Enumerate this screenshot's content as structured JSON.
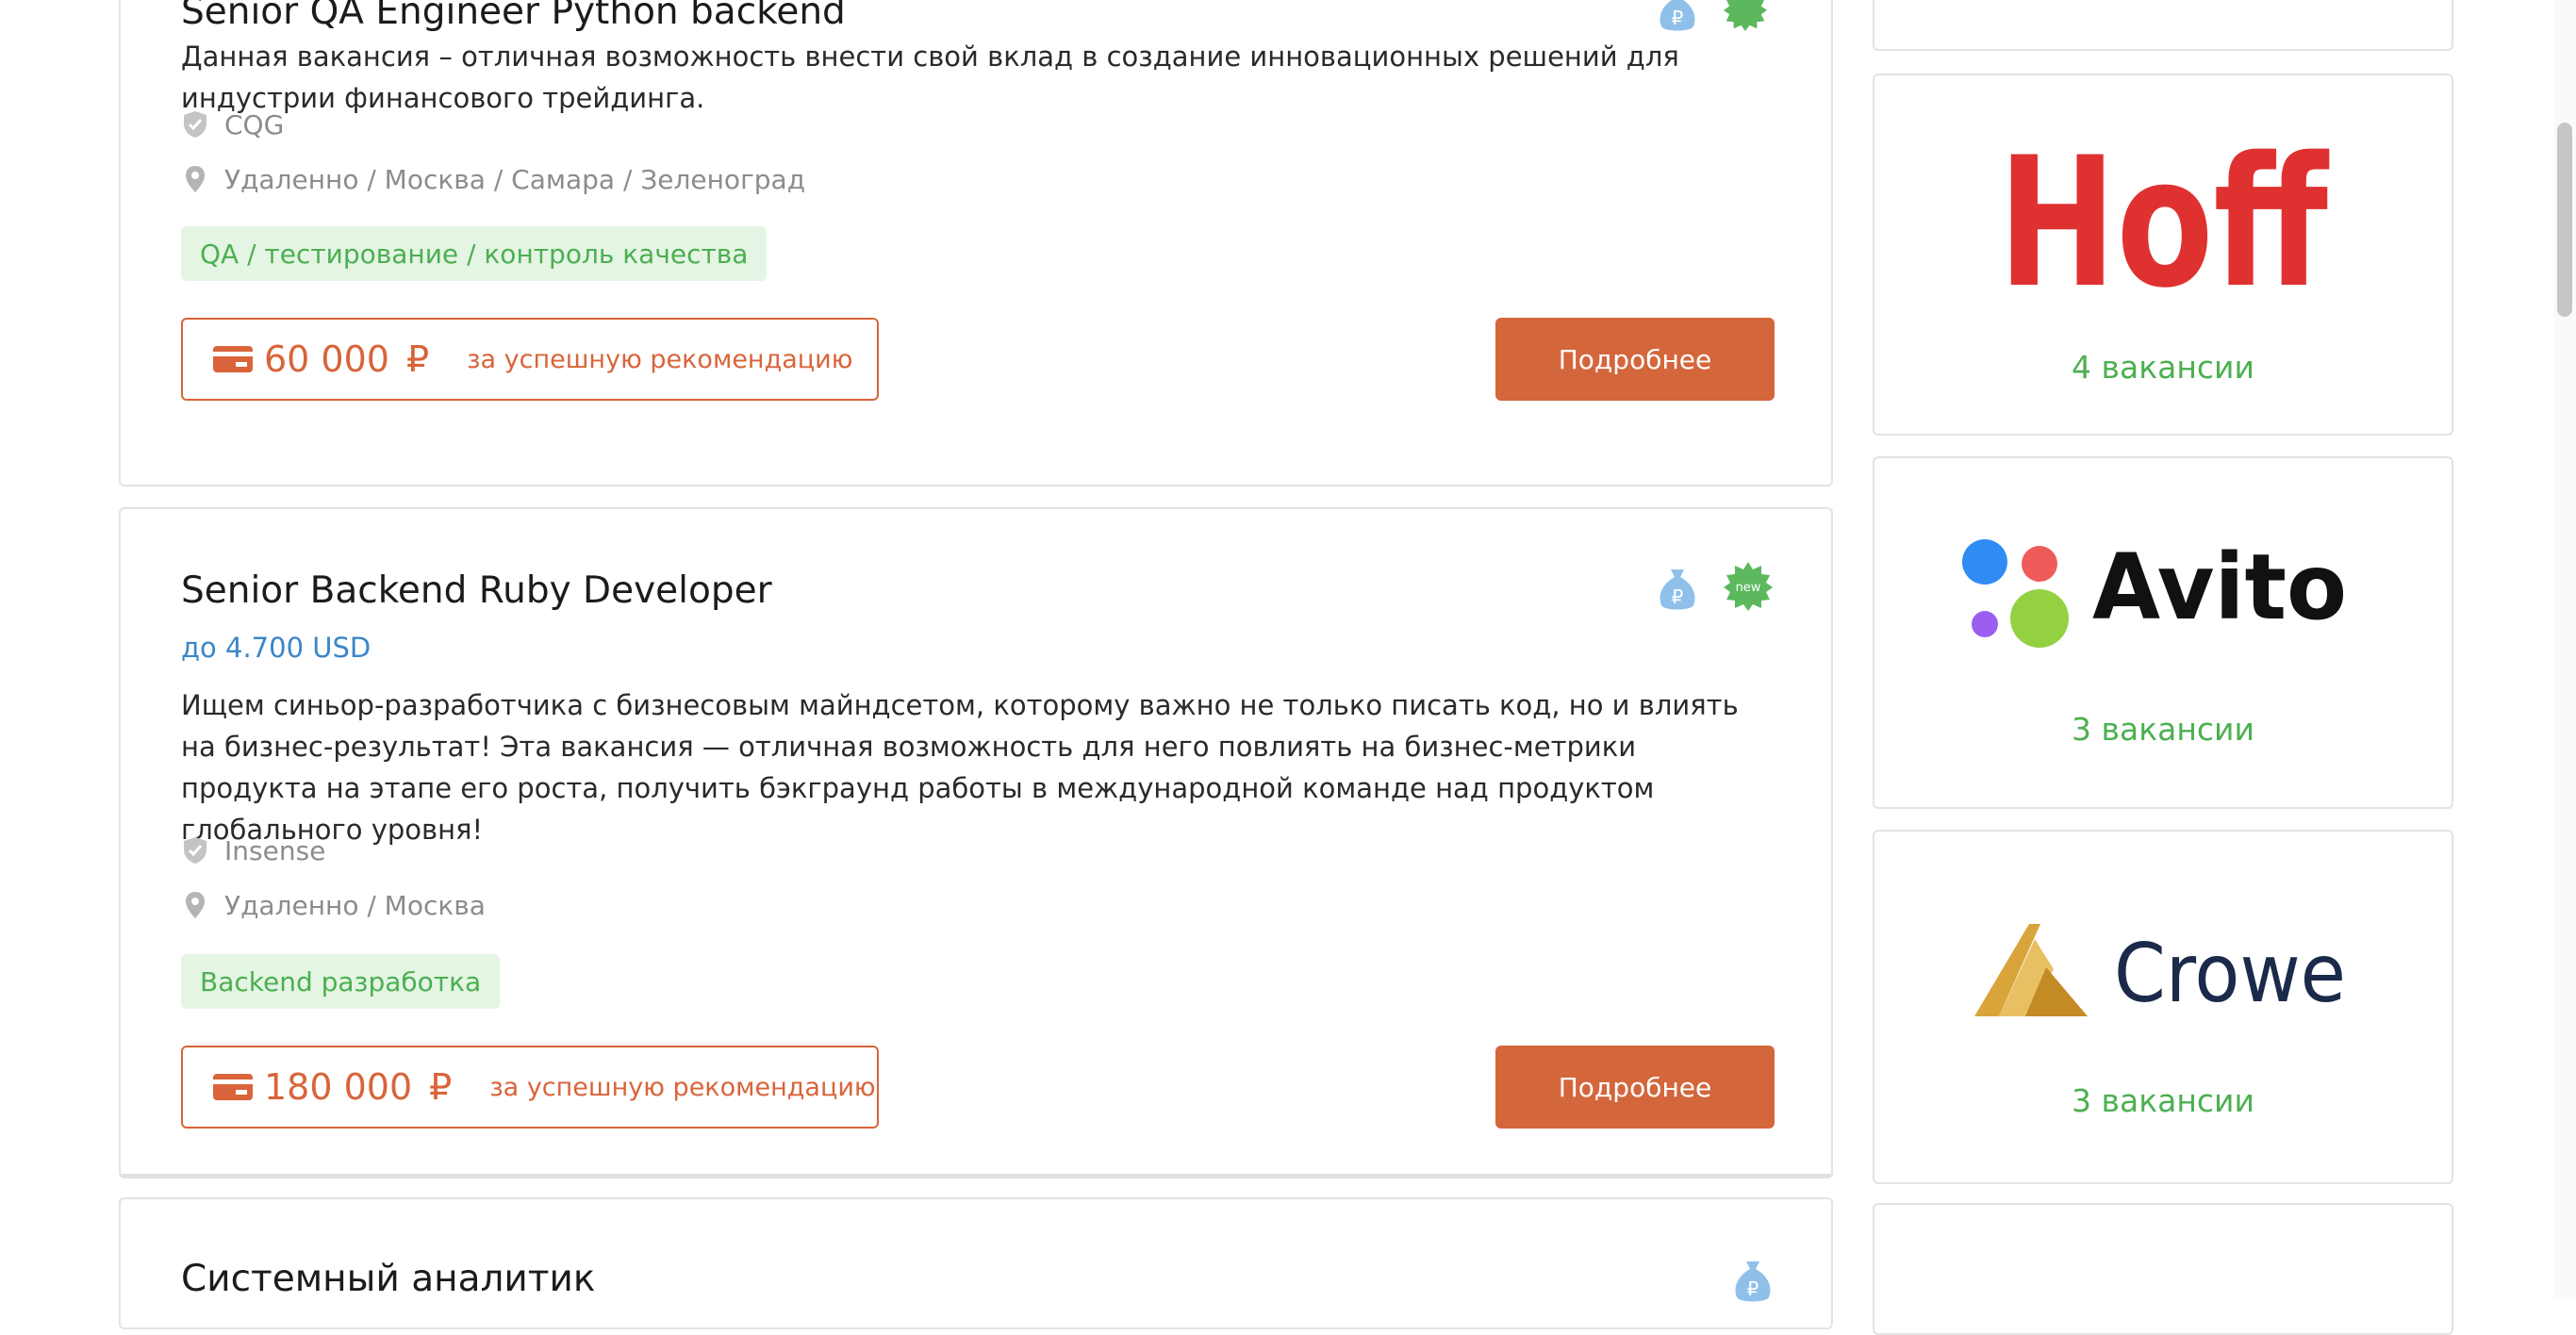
{
  "vacancies": [
    {
      "title": "Senior QA Engineer Python backend",
      "description": "Данная вакансия – отличная возможность внести свой вклад в создание инновационных решений для индустрии финансового трейдинга.",
      "company": "CQG",
      "location": "Удаленно / Москва / Самара / Зеленоград",
      "tag": "QA / тестирование / контроль качества",
      "reward_amount": "60 000",
      "currency_symbol": "₽",
      "reward_text": "за успешную рекомендацию",
      "details_label": "Подробнее"
    },
    {
      "title": "Senior Backend Ruby Developer",
      "salary": "до 4.700 USD",
      "description": "Ищем синьор-разработчика с бизнесовым майндсетом, которому важно не только писать код, но и влиять на бизнес-результат! Эта вакансия — отличная возможность для него повлиять на бизнес-метрики продукта на этапе его роста, получить бэкграунд работы в международной команде над продуктом глобального уровня!",
      "company": "Insense",
      "location": "Удаленно / Москва",
      "tag": "Backend разработка",
      "reward_amount": "180 000",
      "currency_symbol": "₽",
      "reward_text": "за успешную рекомендацию",
      "details_label": "Подробнее",
      "new_badge": "new"
    },
    {
      "title": "Системный аналитик"
    }
  ],
  "companies": [
    {
      "logo": "Hoff",
      "count": "4 вакансии"
    },
    {
      "logo": "Avito",
      "count": "3 вакансии"
    },
    {
      "logo": "Crowe",
      "count": "3 вакансии"
    }
  ],
  "colors": {
    "accent_orange": "#d4663c",
    "tag_green": "#4caf50",
    "salary_blue": "#3a86c8",
    "hoff_red": "#e03131",
    "avito_black": "#111111",
    "crowe_navy": "#1b2a4a",
    "crowe_gold": "#d9a53a"
  },
  "icons": [
    "shield-check-icon",
    "location-pin-icon",
    "card-icon",
    "money-bag-icon",
    "new-badge-icon"
  ]
}
